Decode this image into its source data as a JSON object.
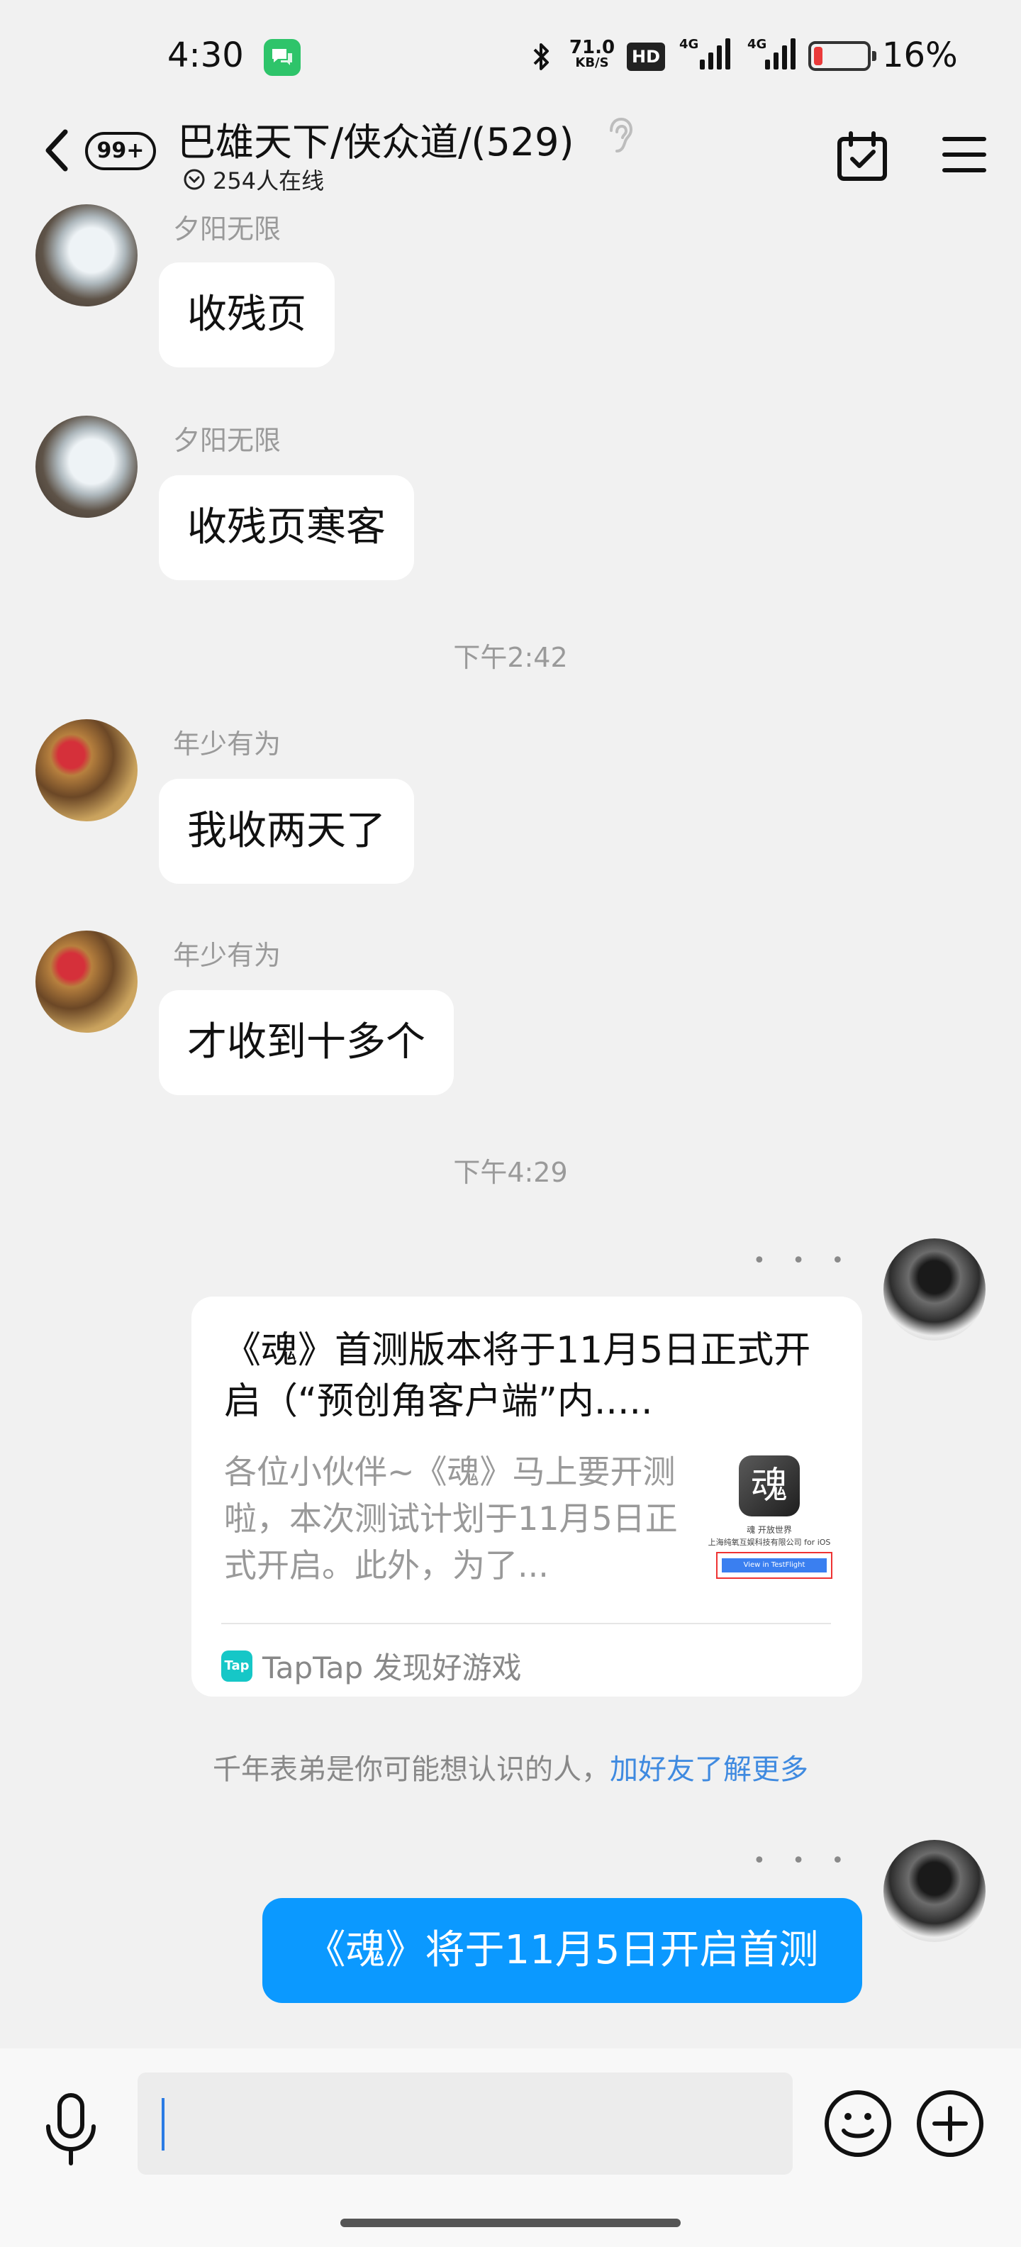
{
  "status_bar": {
    "time": "4:30",
    "net_speed_value": "71.0",
    "net_speed_unit": "KB/S",
    "hd_badge": "HD",
    "signal1_label": "4G",
    "signal2_label": "4G",
    "battery_percent": "16%",
    "battery_level": 0.16,
    "battery_color": "#ea3a3a",
    "notify_icon": "chat-app-icon"
  },
  "header": {
    "unread_badge": "99+",
    "group_title": "巴雄天下/侠众道/(529)",
    "online_count": "254人在线",
    "icons": [
      "back-arrow-icon",
      "ear-icon",
      "calendar-check-icon",
      "menu-icon",
      "chevron-down-icon"
    ]
  },
  "messages": [
    {
      "sender": "夕阳无限",
      "text": "收残页"
    },
    {
      "sender": "夕阳无限",
      "text": "收残页寒客"
    },
    {
      "divider": "下午2:42"
    },
    {
      "sender": "年少有为",
      "text": "我收两天了"
    },
    {
      "sender": "年少有为",
      "text": "才收到十多个"
    },
    {
      "divider": "下午4:29"
    }
  ],
  "share_card": {
    "title": "《魂》首测版本将于11月5日正式开启（“预创角客户端”内.....",
    "description": "各位小伙伴~《魂》马上要开测啦，本次测试计划于11月5日正式开启。此外，为了...",
    "thumb_logo": "魂",
    "thumb_line1": "魂 开放世界",
    "thumb_line2": "上海纯氧互娱科技有限公司 for iOS",
    "thumb_button": "View in TestFlight",
    "source_logo": "Tap",
    "source_text": "TapTap 发现好游戏"
  },
  "suggestion": {
    "text": "千年表弟是你可能想认识的人，",
    "link": "加好友了解更多"
  },
  "my_message": {
    "text": "《魂》将于11月5日开启首测"
  },
  "more_dots": "• • •",
  "input": {
    "value": "",
    "icons": [
      "microphone-icon",
      "emoji-icon",
      "plus-icon"
    ]
  },
  "colors": {
    "accent_blue": "#0b99ff",
    "link_blue": "#3f8ae0",
    "taptap_teal": "#16c7c7",
    "background": "#f1f1f1"
  }
}
